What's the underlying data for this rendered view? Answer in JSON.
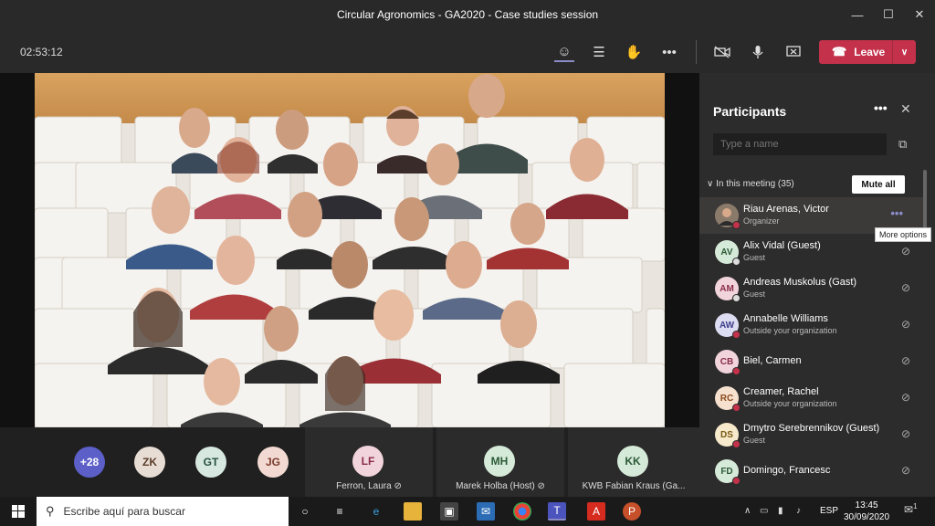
{
  "window": {
    "title": "Circular Agronomics - GA2020 - Case studies session",
    "controls": [
      "minimize",
      "maximize",
      "close"
    ]
  },
  "toolbar": {
    "timer": "02:53:12",
    "leave_label": "Leave",
    "icons": [
      "participants-icon",
      "chat-icon",
      "raise-hand-icon",
      "more-icon",
      "camera-off-icon",
      "mic-icon",
      "share-screen-icon"
    ]
  },
  "strip": {
    "overflow": "+28",
    "avatars": [
      {
        "initials": "ZK",
        "color": "#e8ddd4",
        "text": "#5b3d2a"
      },
      {
        "initials": "GT",
        "color": "#d6e8e0",
        "text": "#28503d"
      },
      {
        "initials": "JG",
        "color": "#f2d9d2",
        "text": "#7a3b2b"
      }
    ],
    "tiles": [
      {
        "initials": "LF",
        "name": "Ferron, Laura",
        "color": "#f2d4dc",
        "text": "#8a2d4a"
      },
      {
        "initials": "MH",
        "name": "Marek Holba (Host)",
        "color": "#d6ead9",
        "text": "#2c5a36"
      },
      {
        "initials": "KK",
        "name": "KWB Fabian Kraus (Ga...",
        "color": "#d6ead9",
        "text": "#2c5a36"
      }
    ]
  },
  "panel": {
    "title": "Participants",
    "search_placeholder": "Type a name",
    "section": "In this meeting (35)",
    "mute_all": "Mute all",
    "tooltip": "More options",
    "participants": [
      {
        "initials": "",
        "name": "Riau Arenas, Victor",
        "role": "Organizer",
        "color": "#7a6a5a",
        "text": "#fff",
        "highlight": true
      },
      {
        "initials": "AV",
        "name": "Alix Vidal (Guest)",
        "role": "Guest",
        "color": "#d6ead9",
        "text": "#2c5a36"
      },
      {
        "initials": "AM",
        "name": "Andreas Muskolus (Gast)",
        "role": "Guest",
        "color": "#f2d4dc",
        "text": "#8a2d4a"
      },
      {
        "initials": "AW",
        "name": "Annabelle Williams",
        "role": "Outside your organization",
        "color": "#dcdcf2",
        "text": "#3d3d8a"
      },
      {
        "initials": "CB",
        "name": "Biel, Carmen",
        "role": "",
        "color": "#f2d4dc",
        "text": "#8a2d4a"
      },
      {
        "initials": "RC",
        "name": "Creamer, Rachel",
        "role": "Outside your organization",
        "color": "#f6e1cf",
        "text": "#8a4a1d"
      },
      {
        "initials": "DS",
        "name": "Dmytro Serebrennikov (Guest)",
        "role": "Guest",
        "color": "#f6e9cc",
        "text": "#7a5a14"
      },
      {
        "initials": "FD",
        "name": "Domingo, Francesc",
        "role": "",
        "color": "#d6ead9",
        "text": "#2c5a36"
      }
    ]
  },
  "taskbar": {
    "search_placeholder": "Escribe aquí para buscar",
    "language": "ESP",
    "time": "13:45",
    "date": "30/09/2020",
    "notifications": "1"
  }
}
